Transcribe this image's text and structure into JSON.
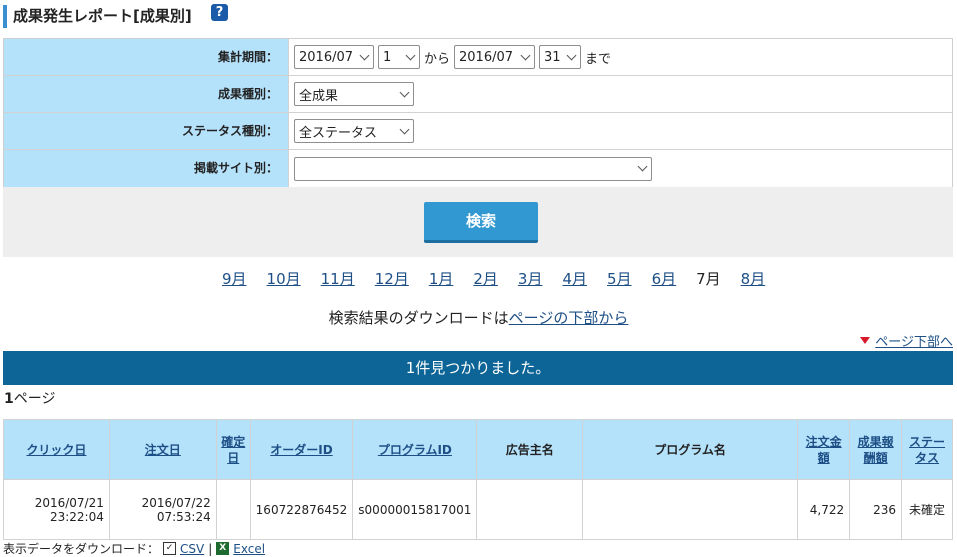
{
  "page": {
    "title": "成果発生レポート[成果別]",
    "help_icon": "?"
  },
  "form": {
    "period_label": "集計期間：",
    "start_month": "2016/07",
    "start_day": "1",
    "from_text": "から",
    "end_month": "2016/07",
    "end_day": "31",
    "until_text": "まで",
    "type_label": "成果種別：",
    "type_value": "全成果",
    "status_label": "ステータス種別：",
    "status_value": "全ステータス",
    "site_label": "掲載サイト別：",
    "site_value": "",
    "search_label": "検索"
  },
  "months": [
    "9月",
    "10月",
    "11月",
    "12月",
    "1月",
    "2月",
    "3月",
    "4月",
    "5月",
    "6月",
    "7月",
    "8月"
  ],
  "current_month": "7月",
  "download_note": {
    "prefix": "検索結果のダウンロードは",
    "link": "ページの下部から"
  },
  "to_bottom": "ページ下部へ",
  "result_summary": "1件見つかりました。",
  "page_indicator": {
    "num": "1",
    "suffix": "ページ"
  },
  "table": {
    "headers": {
      "click_date": "クリック日",
      "order_date": "注文日",
      "confirm_date": "確定日",
      "order_id": "オーダーID",
      "program_id": "プログラムID",
      "advertiser": "広告主名",
      "program_name": "プログラム名",
      "amount": "注文金額",
      "reward": "成果報酬額",
      "status": "ステータス"
    },
    "rows": [
      {
        "click_date": "2016/07/21",
        "click_time": "23:22:04",
        "order_date": "2016/07/22",
        "order_time": "07:53:24",
        "confirm_date": "",
        "order_id": "160722876452",
        "program_id": "s00000015817001",
        "advertiser": "",
        "program_name": "",
        "amount": "4,722",
        "reward": "236",
        "status": "未確定"
      }
    ]
  },
  "download": {
    "label": "表示データをダウンロード：",
    "csv": "CSV",
    "sep": "|",
    "excel": "Excel"
  }
}
